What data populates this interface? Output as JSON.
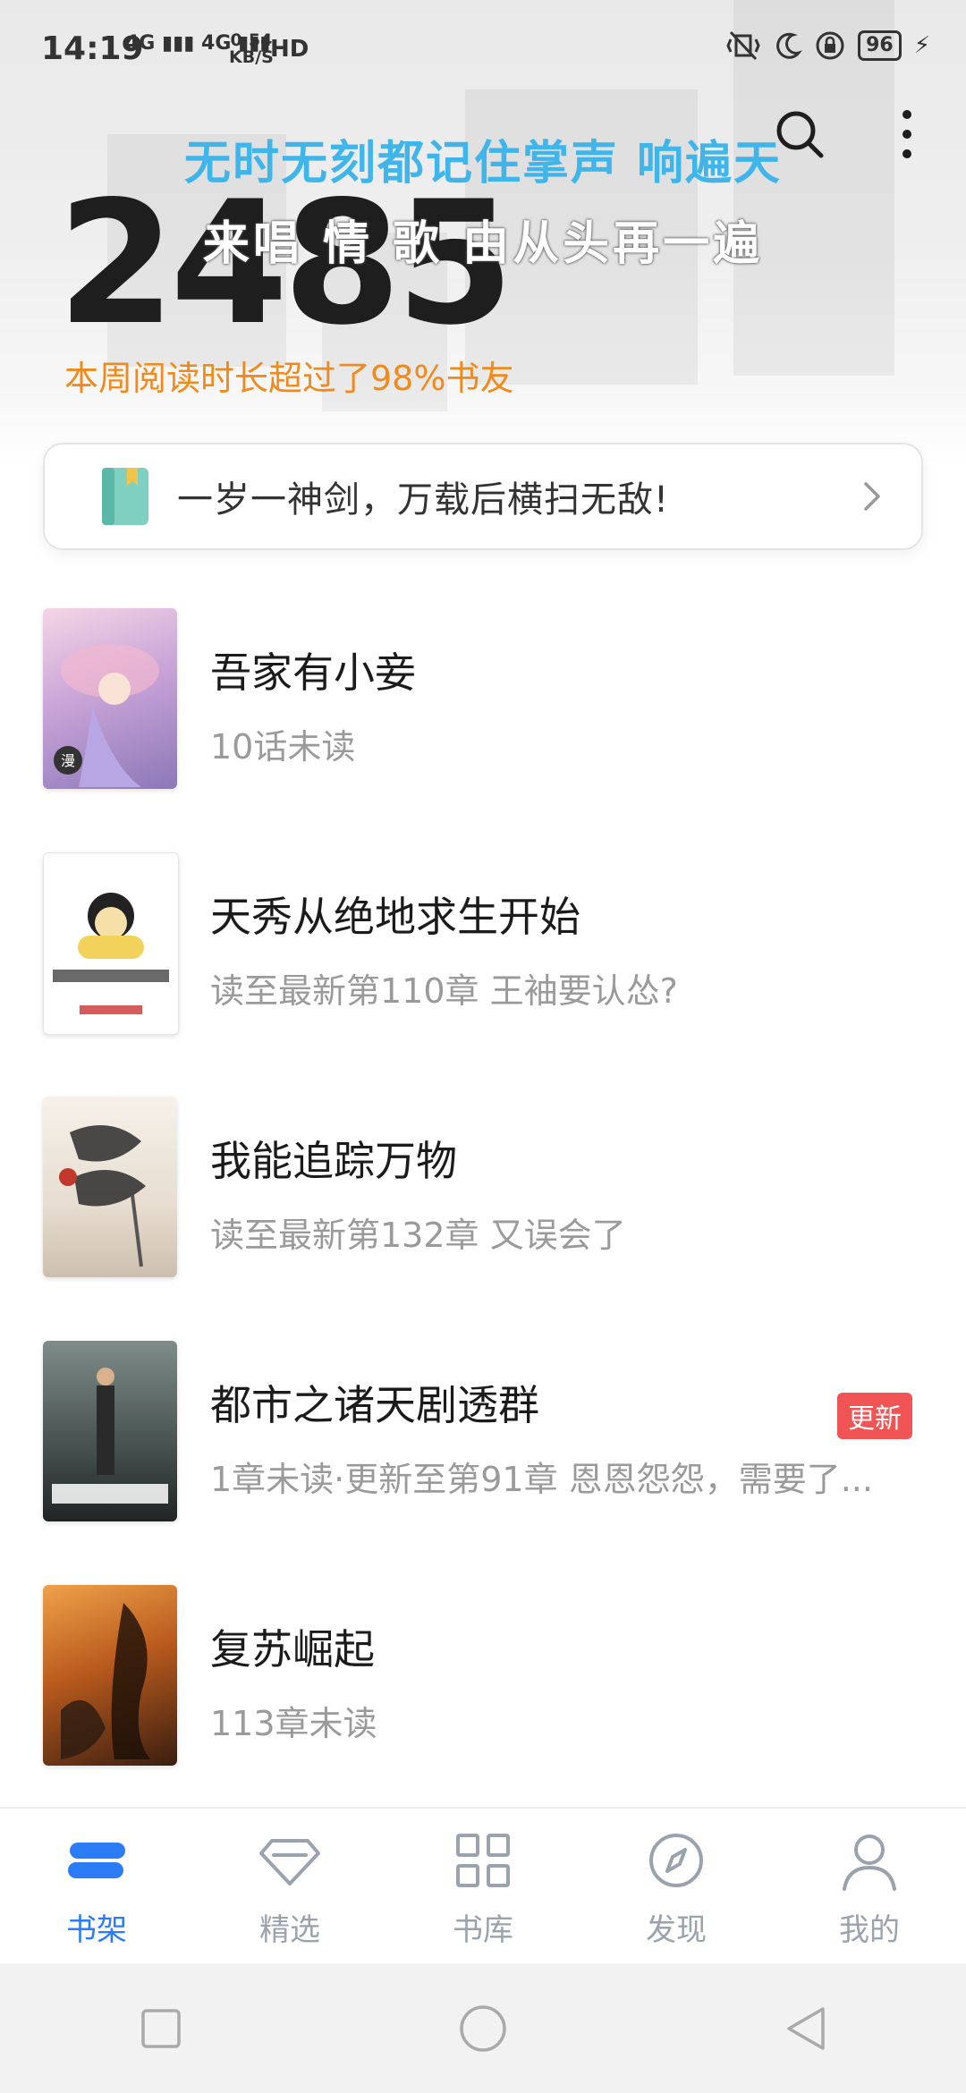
{
  "status_bar": {
    "time": "14:19",
    "network1": "4G",
    "network2": "4G",
    "speed_value": "0.54",
    "speed_unit": "KB/S",
    "hd": "HD",
    "battery": "96"
  },
  "header": {
    "lyrics_line1": "无时无刻都记住掌声 响遍天",
    "lyrics_line2": "来唱 情 歌 由从头再一遍",
    "reading_time": "2485",
    "reading_caption": "本周阅读时长超过了98%书友"
  },
  "banner": {
    "text": "一岁一神剑，万载后横扫无敌!"
  },
  "books": [
    {
      "title": "吾家有小妾",
      "subtitle": "10话未读",
      "badge": ""
    },
    {
      "title": "天秀从绝地求生开始",
      "subtitle": "读至最新第110章 王袖要认怂?",
      "badge": ""
    },
    {
      "title": "我能追踪万物",
      "subtitle": "读至最新第132章 又误会了",
      "badge": ""
    },
    {
      "title": "都市之诸天剧透群",
      "subtitle": "1章未读·更新至第91章 恩恩怨怨，需要了...",
      "badge": "更新"
    },
    {
      "title": "复苏崛起",
      "subtitle": "113章未读",
      "badge": ""
    }
  ],
  "tabs": [
    {
      "label": "书架",
      "icon": "bookshelf-icon",
      "active": true
    },
    {
      "label": "精选",
      "icon": "diamond-icon",
      "active": false
    },
    {
      "label": "书库",
      "icon": "grid-icon",
      "active": false
    },
    {
      "label": "发现",
      "icon": "compass-icon",
      "active": false
    },
    {
      "label": "我的",
      "icon": "user-icon",
      "active": false
    }
  ],
  "colors": {
    "accent": "#2c7cf6",
    "lyrics": "#3fb5ea",
    "caption_orange": "#f08a1c",
    "badge_red": "#f05454"
  }
}
